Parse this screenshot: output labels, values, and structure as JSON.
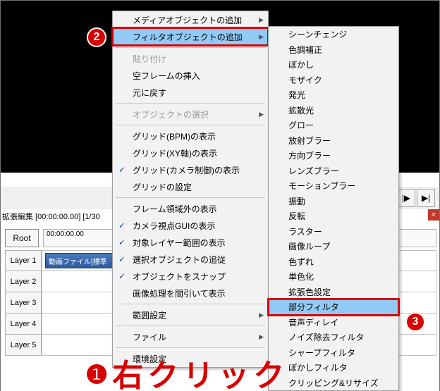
{
  "colors": {
    "accent_red": "#d70000",
    "highlight_blue": "#91c9f7"
  },
  "annotations": {
    "label1_num": "❶",
    "label1_text": "右クリック",
    "badge2": "2",
    "badge3": "3"
  },
  "transport": {
    "rew": "|◀",
    "step_back": "◀|",
    "play": "▶",
    "step_fwd": "|▶",
    "fwd": "▶|"
  },
  "timeline": {
    "title": "拡張編集 [00:00:00.00] [1/30",
    "root_button": "Root",
    "ruler_start": "00:00:00.00",
    "layers": [
      "Layer 1",
      "Layer 2",
      "Layer 3",
      "Layer 4",
      "Layer 5"
    ],
    "clip1": "動画ファイル[標準"
  },
  "menu_left": {
    "items": [
      {
        "label": "メディアオブジェクトの追加",
        "sub": true
      },
      {
        "label": "フィルタオブジェクトの追加",
        "sub": true,
        "hl": true
      },
      {
        "sep": true
      },
      {
        "label": "貼り付け",
        "disabled": true
      },
      {
        "label": "空フレームの挿入"
      },
      {
        "label": "元に戻す"
      },
      {
        "sep": true
      },
      {
        "label": "オブジェクトの選択",
        "sub": true,
        "disabled": true
      },
      {
        "sep": true
      },
      {
        "label": "グリッド(BPM)の表示"
      },
      {
        "label": "グリッド(XY軸)の表示"
      },
      {
        "label": "グリッド(カメラ制御)の表示",
        "check": true
      },
      {
        "label": "グリッドの設定"
      },
      {
        "sep": true
      },
      {
        "label": "フレーム領域外の表示"
      },
      {
        "label": "カメラ視点GUIの表示",
        "check": true
      },
      {
        "label": "対象レイヤー範囲の表示",
        "check": true
      },
      {
        "label": "選択オブジェクトの追従",
        "check": true
      },
      {
        "label": "オブジェクトをスナップ",
        "check": true
      },
      {
        "label": "画像処理を間引いて表示"
      },
      {
        "sep": true
      },
      {
        "label": "範囲設定",
        "sub": true
      },
      {
        "sep": true
      },
      {
        "label": "ファイル",
        "sub": true
      },
      {
        "sep": true
      },
      {
        "label": "環境設定"
      }
    ]
  },
  "menu_right": {
    "items": [
      "シーンチェンジ",
      "色調補正",
      "ぼかし",
      "モザイク",
      "発光",
      "拡散光",
      "グロー",
      "放射ブラー",
      "方向ブラー",
      "レンズブラー",
      "モーションブラー",
      "振動",
      "反転",
      "ラスター",
      "画像ループ",
      "色ずれ",
      "単色化",
      "拡張色設定",
      "部分フィルタ",
      "音声ディレイ",
      "ノイズ除去フィルタ",
      "シャープフィルタ",
      "ぼかしフィルタ",
      "クリッピング&リサイズ"
    ],
    "highlight_index": 18
  }
}
